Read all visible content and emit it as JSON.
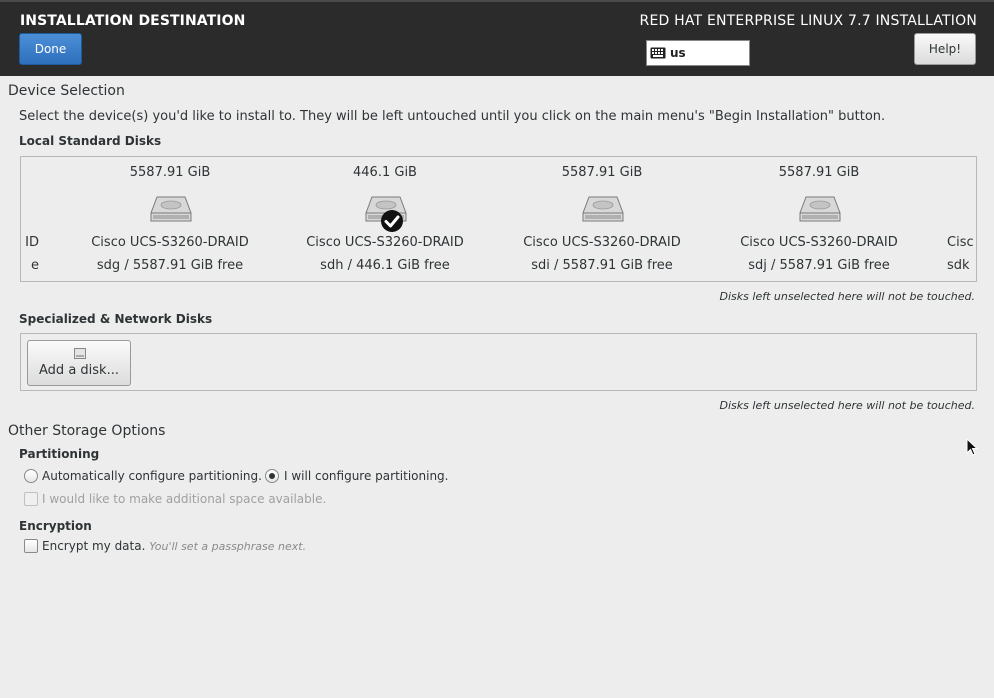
{
  "header": {
    "title": "INSTALLATION DESTINATION",
    "done_label": "Done",
    "product": "RED HAT ENTERPRISE LINUX 7.7 INSTALLATION",
    "keyboard_layout": "us",
    "keyboard_icon": "keyboard-icon",
    "help_label": "Help!",
    "accent_color": "#3874c8",
    "header_bg": "#2b2b2b"
  },
  "device_selection": {
    "heading": "Device Selection",
    "instructions": "Select the device(s) you'd like to install to.  They will be left untouched until you click on the main menu's \"Begin Installation\" button.",
    "local_heading": "Local Standard Disks",
    "local_hint": "Disks left unselected here will not be touched.",
    "disks": [
      {
        "size": "",
        "model": "ID",
        "info": "e",
        "selected": false
      },
      {
        "size": "5587.91 GiB",
        "model": "Cisco UCS-S3260-DRAID",
        "info": "sdg  /  5587.91 GiB free",
        "selected": false
      },
      {
        "size": "446.1 GiB",
        "model": "Cisco UCS-S3260-DRAID",
        "info": "sdh   /   446.1 GiB free",
        "selected": true
      },
      {
        "size": "5587.91 GiB",
        "model": "Cisco UCS-S3260-DRAID",
        "info": "sdi  /  5587.91 GiB free",
        "selected": false
      },
      {
        "size": "5587.91 GiB",
        "model": "Cisco UCS-S3260-DRAID",
        "info": "sdj  /  5587.91 GiB free",
        "selected": false
      },
      {
        "size": "",
        "model": "Cisc",
        "info": "sdk",
        "selected": false
      }
    ],
    "specialized_heading": "Specialized & Network Disks",
    "add_disk_label": "Add a disk...",
    "specialized_hint": "Disks left unselected here will not be touched."
  },
  "other_storage": {
    "heading": "Other Storage Options",
    "partitioning_heading": "Partitioning",
    "auto_label": "Automatically configure partitioning.",
    "auto_selected": false,
    "manual_label": "I will configure partitioning.",
    "manual_selected": true,
    "additional_space_label": "I would like to make additional space available.",
    "additional_space_enabled": false,
    "encryption_heading": "Encryption",
    "encrypt_label": "Encrypt my data.",
    "encrypt_note": "You'll set a passphrase next.",
    "encrypt_checked": false
  }
}
